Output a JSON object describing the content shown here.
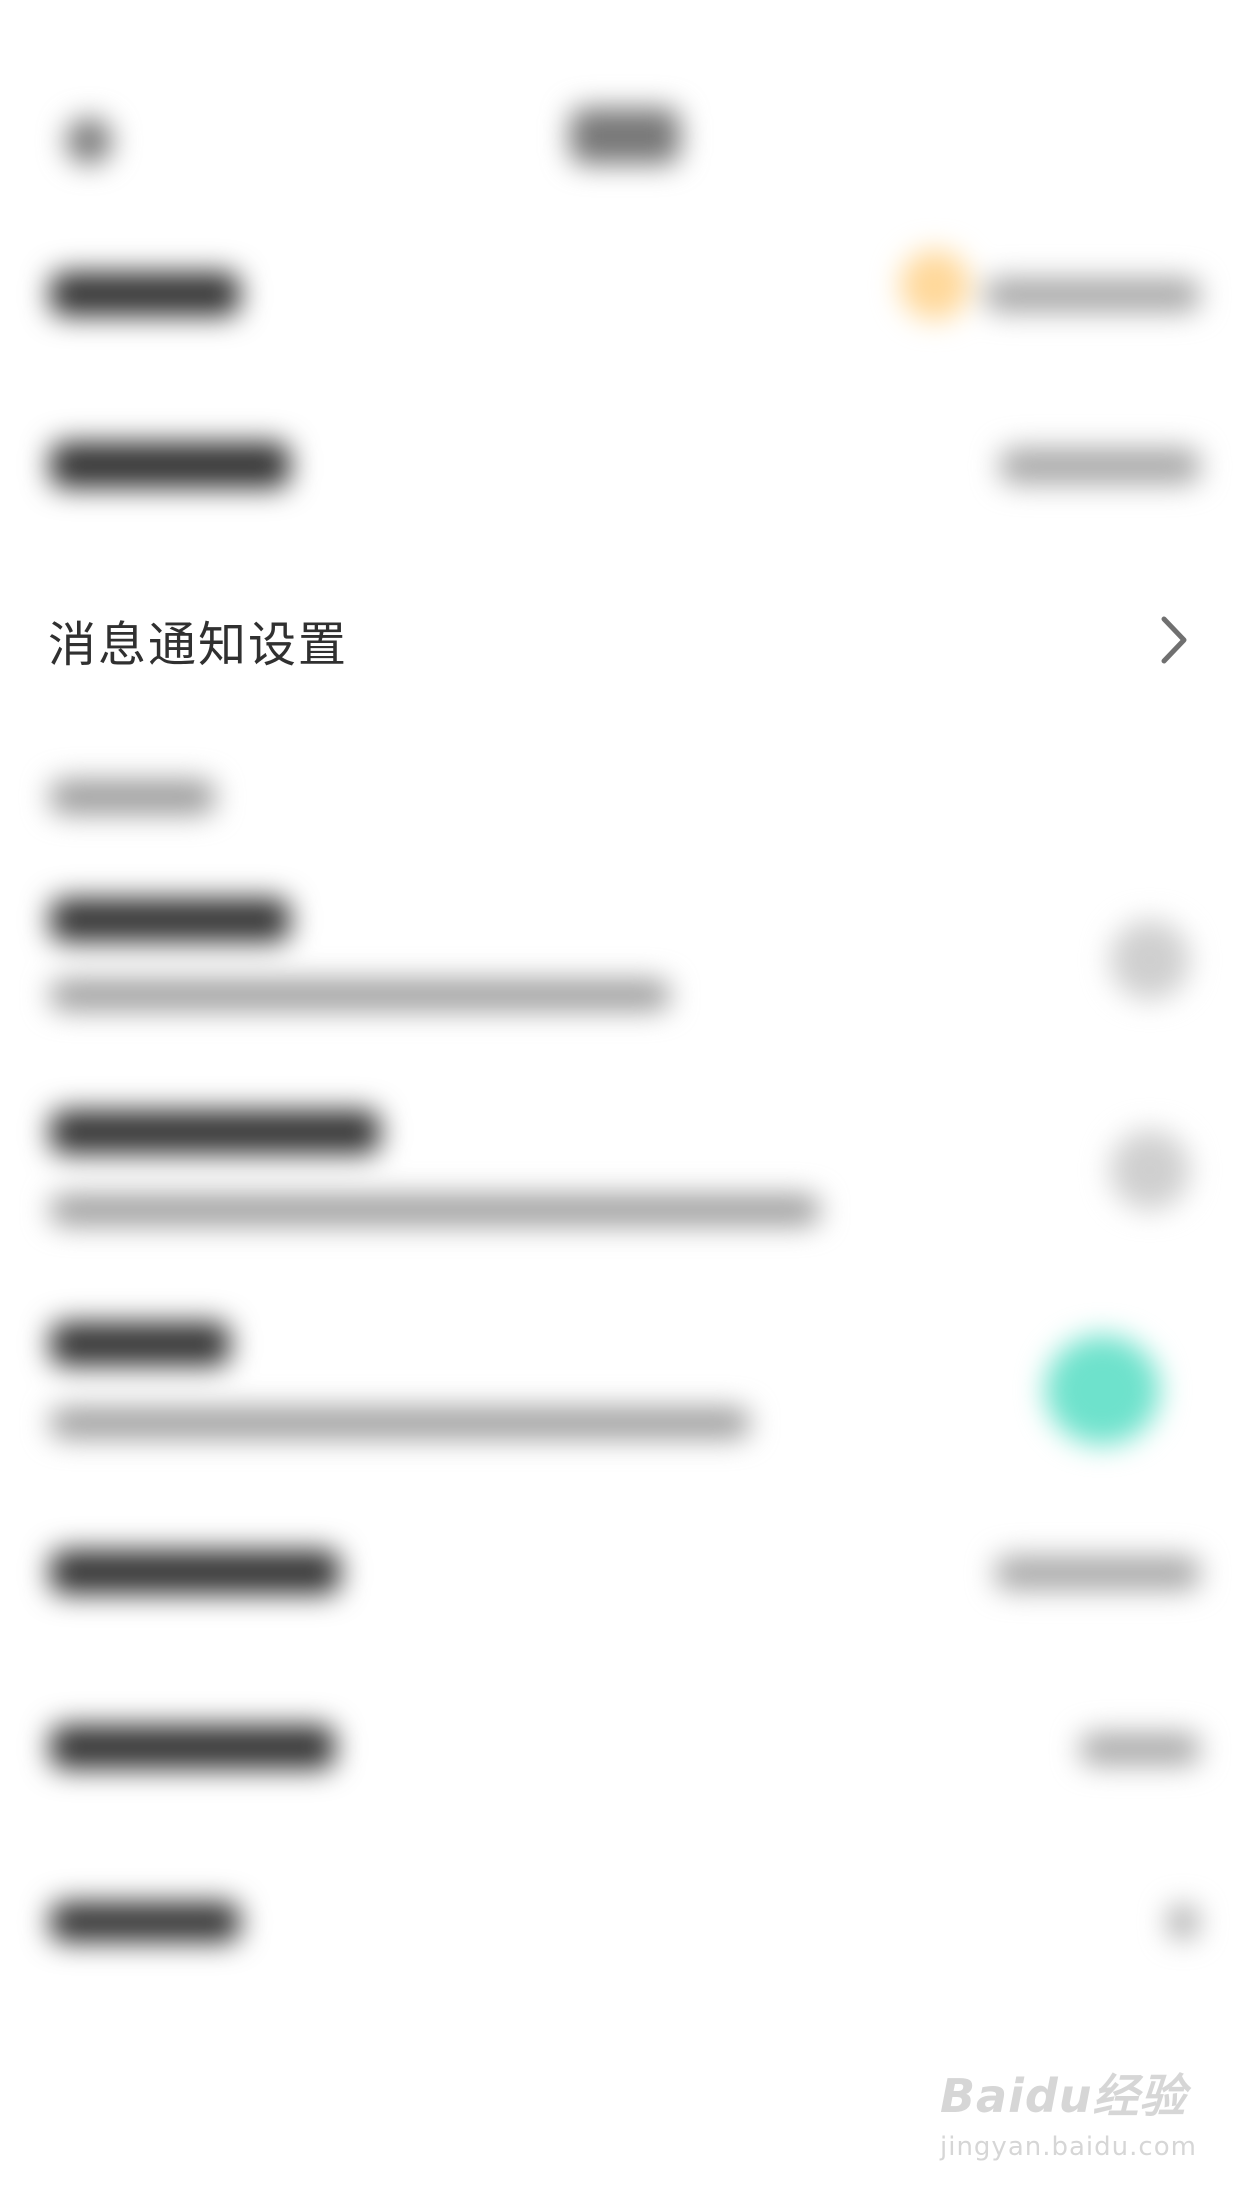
{
  "settings": {
    "notification_row": {
      "label": "消息通知设置",
      "chevron_icon": "chevron-right-icon"
    }
  },
  "colors": {
    "accent_orange": "#ffd89a",
    "toggle_teal": "#6ee2cc",
    "text_primary": "#303030",
    "chevron": "#707070"
  },
  "watermark": {
    "logo_text": "Baidu经验",
    "domain_text": "jingyan.baidu.com"
  }
}
